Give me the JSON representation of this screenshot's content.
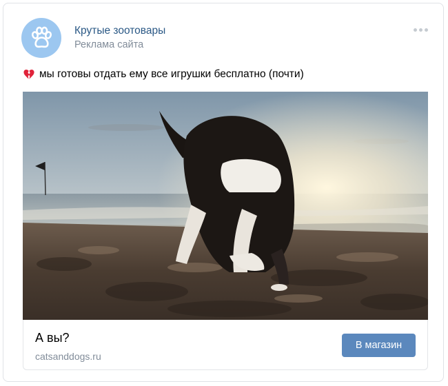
{
  "post": {
    "author_name": "Крутые зоотовары",
    "subtitle": "Реклама сайта",
    "text": "мы готовы отдать ему все игрушки бесплатно (почти)",
    "emoji": "broken-heart-icon"
  },
  "attachment": {
    "title": "А вы?",
    "domain": "catsanddogs.ru",
    "button_label": "В магазин"
  },
  "colors": {
    "link": "#2a5885",
    "secondary_text": "#818c99",
    "button": "#5b88bd",
    "avatar_bg": "#9cc7f0"
  }
}
